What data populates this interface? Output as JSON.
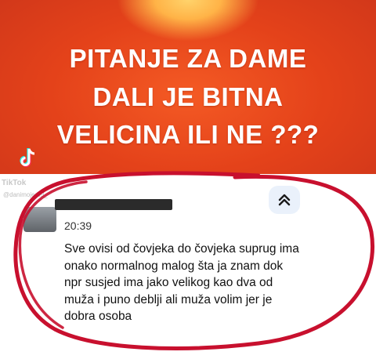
{
  "banner": {
    "line1": "PITANJE ZA DAME",
    "line2": "DALI JE BITNA",
    "line3": "VELICINA ILI NE ???"
  },
  "watermark": {
    "brand": "TikTok",
    "handle": "@danimojero9_"
  },
  "comment": {
    "time": "20:39",
    "lines": [
      "Sve ovisi od čovjeka do čovjeka suprug ima",
      "onako normalnog malog šta ja znam dok",
      "npr susjed ima jako velikog kao dva od",
      "muža i puno deblji ali muža volim jer je",
      "dobra osoba"
    ]
  },
  "colors": {
    "banner": "#e4421a",
    "annotation": "#c8102e",
    "scroll_button_bg": "#eaf1fb",
    "scroll_icon": "#1a73e8"
  },
  "icons": {
    "scroll": "chevrons-up-icon",
    "logo": "tiktok-logo-icon"
  }
}
